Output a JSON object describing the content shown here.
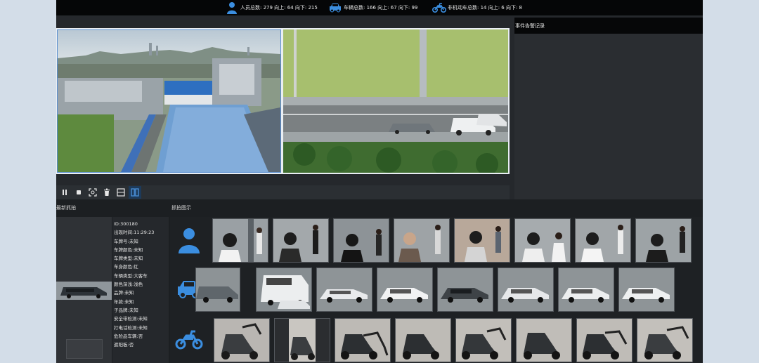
{
  "stats": {
    "people": "人员总数: 279 向上: 64 向下: 215",
    "vehicles": "车辆总数: 166 向上: 67 向下: 99",
    "nonmotor": "非机动车总数: 14 向上: 6 向下: 8"
  },
  "icons": {
    "people": "person-icon",
    "vehicles": "car-icon",
    "nonmotor": "motorcycle-icon"
  },
  "alarm": {
    "title": "事件告警记录"
  },
  "labels": {
    "latest": "最新抓拍",
    "capture": "抓拍图示"
  },
  "info_lines": [
    "ID:300180",
    "出现时间:11:29:23",
    "车牌号:未知",
    "车牌颜色:未知",
    "车牌类型:未知",
    "车身颜色:红",
    "车辆类型:大客车",
    "颜色深浅:浅色",
    "品牌:未知",
    "年款:未知",
    "子品牌:未知",
    "安全带检测:未知",
    "打电话检测:未知",
    "危险品车辆:否",
    "遮阳板:否"
  ],
  "controls": [
    "pause-icon",
    "stop-icon",
    "snapshot-icon",
    "trash-icon",
    "single-view-icon",
    "split-view-icon"
  ],
  "colors": {
    "accent": "#4a90d9",
    "bar": "#050607",
    "panel": "#25282c"
  }
}
